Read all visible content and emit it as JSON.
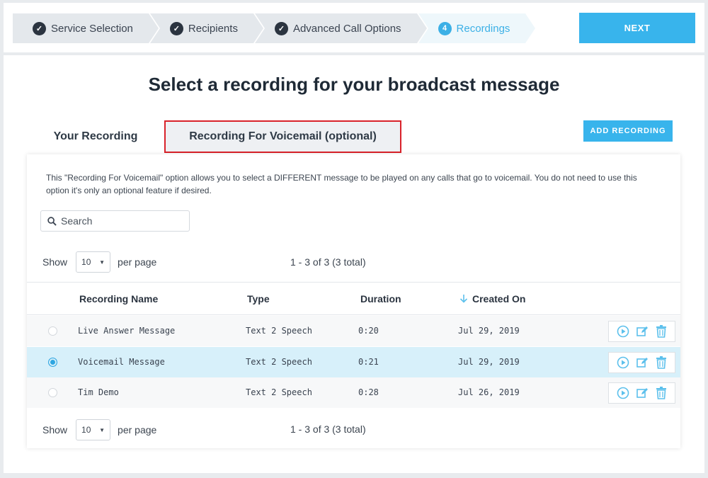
{
  "wizard": {
    "steps": [
      {
        "label": "Service Selection",
        "marker": "✓"
      },
      {
        "label": "Recipients",
        "marker": "✓"
      },
      {
        "label": "Advanced Call Options",
        "marker": "✓"
      },
      {
        "label": "Recordings",
        "marker": "4"
      }
    ],
    "next_label": "NEXT"
  },
  "page": {
    "title": "Select a recording for your broadcast message"
  },
  "tabs": {
    "your_recording": "Your Recording",
    "voicemail": "Recording For Voicemail (optional)"
  },
  "add_recording_label": "ADD RECORDING",
  "description": "This \"Recording For Voicemail\" option allows you to select a DIFFERENT message to be played on any calls that go to voicemail. You do not need to use this option it's only an optional feature if desired.",
  "search": {
    "placeholder": "Search"
  },
  "pager": {
    "show": "Show",
    "per_page_value": "10",
    "per_page": "per page",
    "count": "1 - 3 of 3 (3 total)"
  },
  "table": {
    "headers": {
      "name": "Recording Name",
      "type": "Type",
      "duration": "Duration",
      "created": "Created On"
    },
    "rows": [
      {
        "name": "Live Answer Message",
        "type": "Text 2 Speech",
        "duration": "0:20",
        "created": "Jul 29, 2019",
        "selected": false
      },
      {
        "name": "Voicemail Message",
        "type": "Text 2 Speech",
        "duration": "0:21",
        "created": "Jul 29, 2019",
        "selected": true
      },
      {
        "name": "Tim Demo",
        "type": "Text 2 Speech",
        "duration": "0:28",
        "created": "Jul 26, 2019",
        "selected": false
      }
    ]
  },
  "colors": {
    "accent": "#38b4ec",
    "selected_row": "#d7f0fa",
    "highlight_border": "#d9222a"
  },
  "icons": [
    "check-icon",
    "search-icon",
    "sort-down-arrow-icon",
    "play-icon",
    "edit-icon",
    "trash-icon"
  ]
}
